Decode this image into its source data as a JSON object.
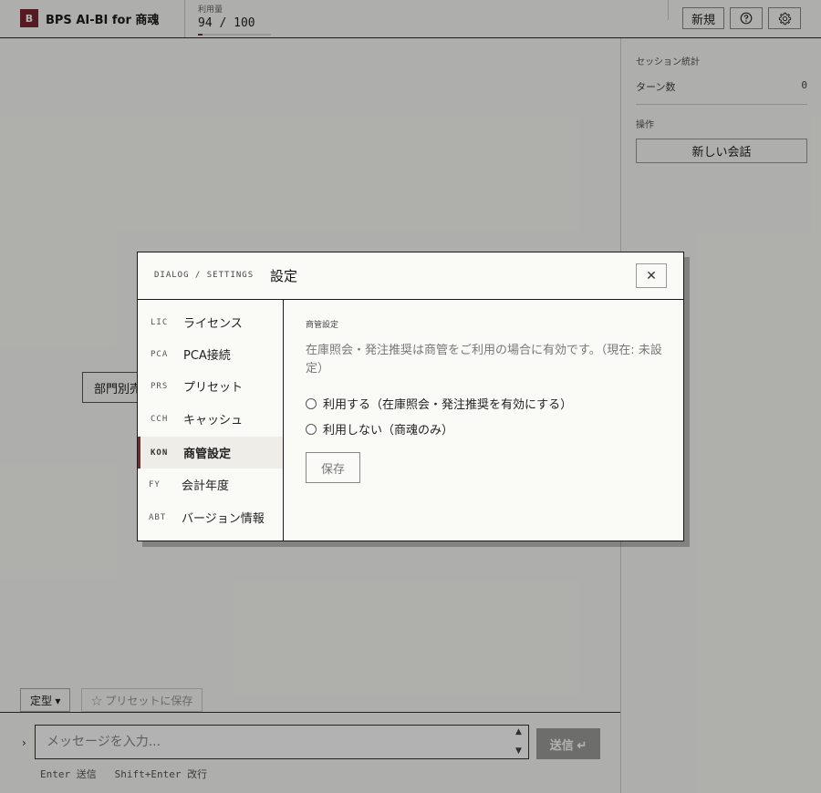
{
  "header": {
    "logo_letter": "B",
    "app_title": "BPS AI-BI for 商魂",
    "usage_label": "利用量",
    "usage_value": "94 / 100",
    "usage_fraction": 0.06,
    "new_label": "新規",
    "help_icon": "help-icon",
    "settings_icon": "gear-icon"
  },
  "side": {
    "stats_heading": "セッション統計",
    "turns_label": "ターン数",
    "turns_value": "0",
    "ops_heading": "操作",
    "new_chat_label": "新しい会話"
  },
  "chat": {
    "chip_text": "部門別売",
    "template_label": "定型 ▾",
    "save_preset_label": "☆ プリセットに保存",
    "prompt_mark": "›",
    "input_placeholder": "メッセージを入力...",
    "send_label": "送信 ↵",
    "hint": "Enter 送信   Shift+Enter 改行"
  },
  "dialog": {
    "crumb": "DIALOG / SETTINGS",
    "title": "設定",
    "close_label": "✕",
    "nav": [
      {
        "code": "LIC",
        "label": "ライセンス"
      },
      {
        "code": "PCA",
        "label": "PCA接続"
      },
      {
        "code": "PRS",
        "label": "プリセット"
      },
      {
        "code": "CCH",
        "label": "キャッシュ"
      },
      {
        "code": "KON",
        "label": "商管設定"
      },
      {
        "code": "FY",
        "label": "会計年度"
      },
      {
        "code": "ABT",
        "label": "バージョン情報"
      }
    ],
    "active_nav": "KON",
    "section_label": "商管設定",
    "description": "在庫照会・発注推奨は商管をご利用の場合に有効です。（現在: 未設定）",
    "options": [
      "利用する（在庫照会・発注推奨を有効にする）",
      "利用しない（商魂のみ）"
    ],
    "save_label": "保存"
  },
  "colors": {
    "accent": "#7b2530",
    "background": "#fafaf7"
  }
}
